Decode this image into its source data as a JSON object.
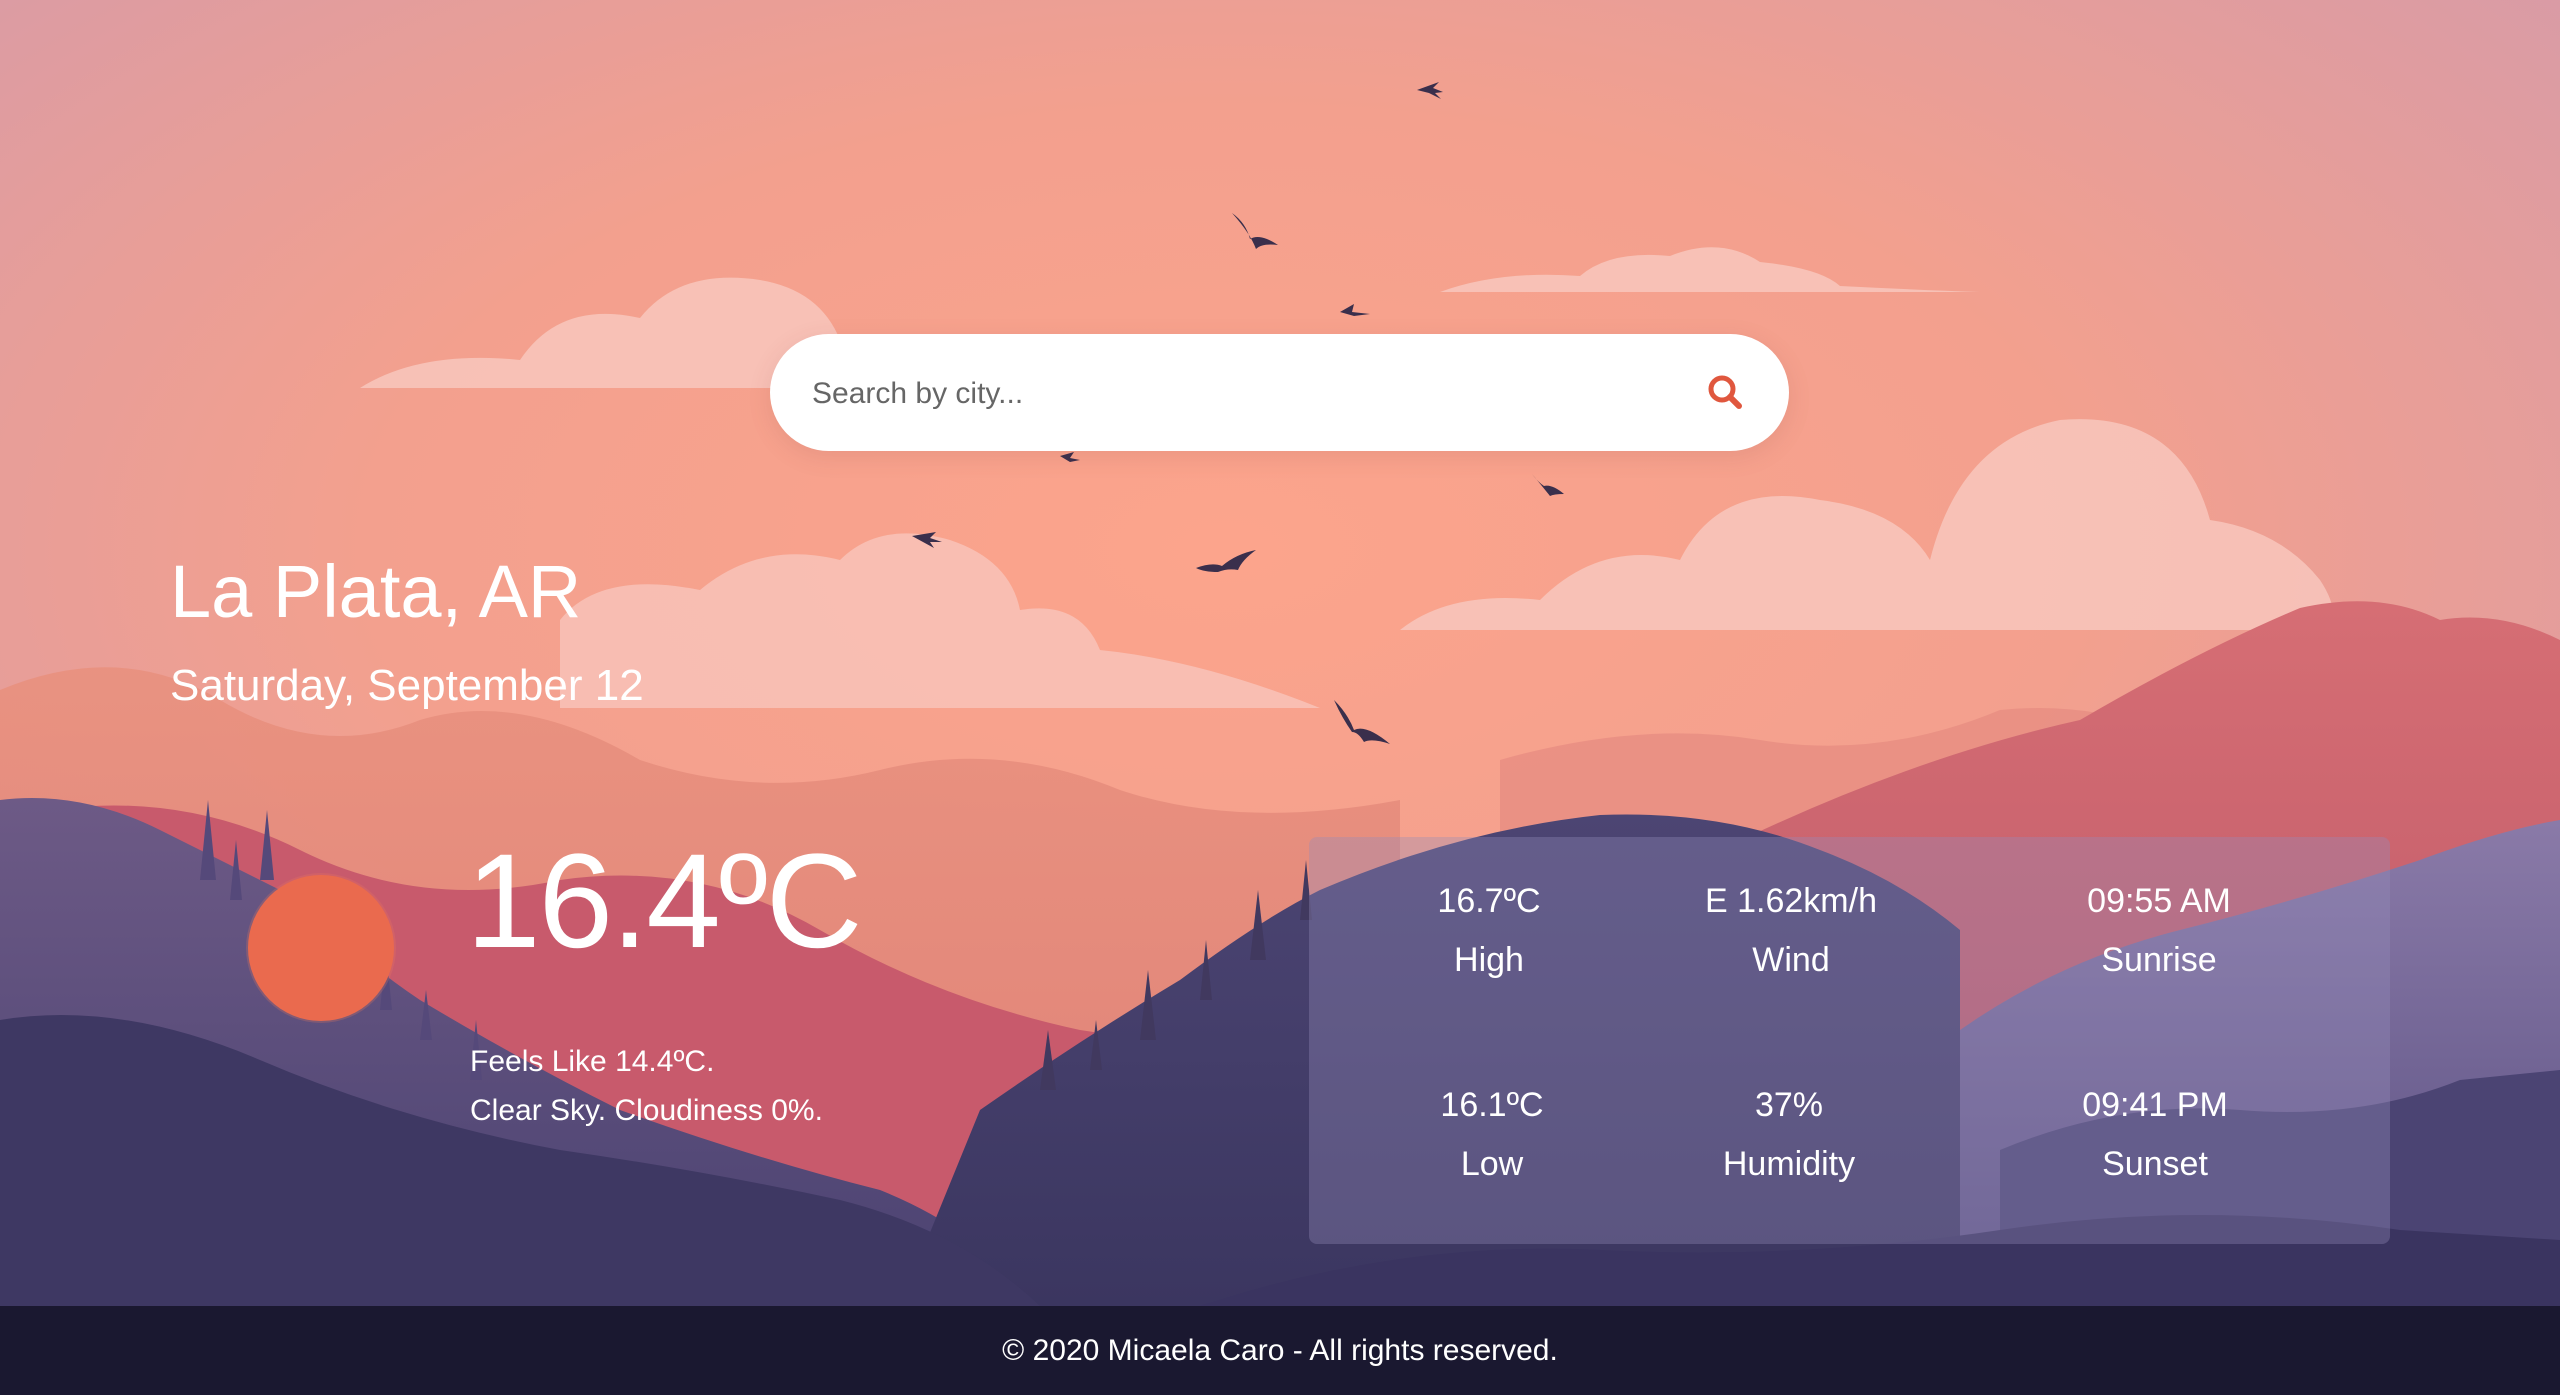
{
  "search": {
    "placeholder": "Search by city...",
    "value": ""
  },
  "location": {
    "city": "La Plata, AR",
    "date": "Saturday, September 12"
  },
  "current": {
    "temperature": "16.4ºC",
    "feels_like": "Feels Like 14.4ºC.",
    "description": "Clear Sky. Cloudiness 0%."
  },
  "stats": [
    {
      "value": "16.7ºC",
      "label": "High"
    },
    {
      "value": "E 1.62km/h",
      "label": "Wind"
    },
    {
      "value": "09:55 AM",
      "label": "Sunrise"
    },
    {
      "value": "16.1ºC",
      "label": "Low"
    },
    {
      "value": "37%",
      "label": "Humidity"
    },
    {
      "value": "09:41 PM",
      "label": "Sunset"
    }
  ],
  "footer": {
    "text": "© 2020 Micaela Caro - All rights reserved."
  },
  "colors": {
    "sun": "#ea6a4e",
    "search_icon": "#e0573e",
    "footer_bg": "#1a1830",
    "sky_top": "#d9a0a8",
    "sky_glow": "#fba890"
  }
}
